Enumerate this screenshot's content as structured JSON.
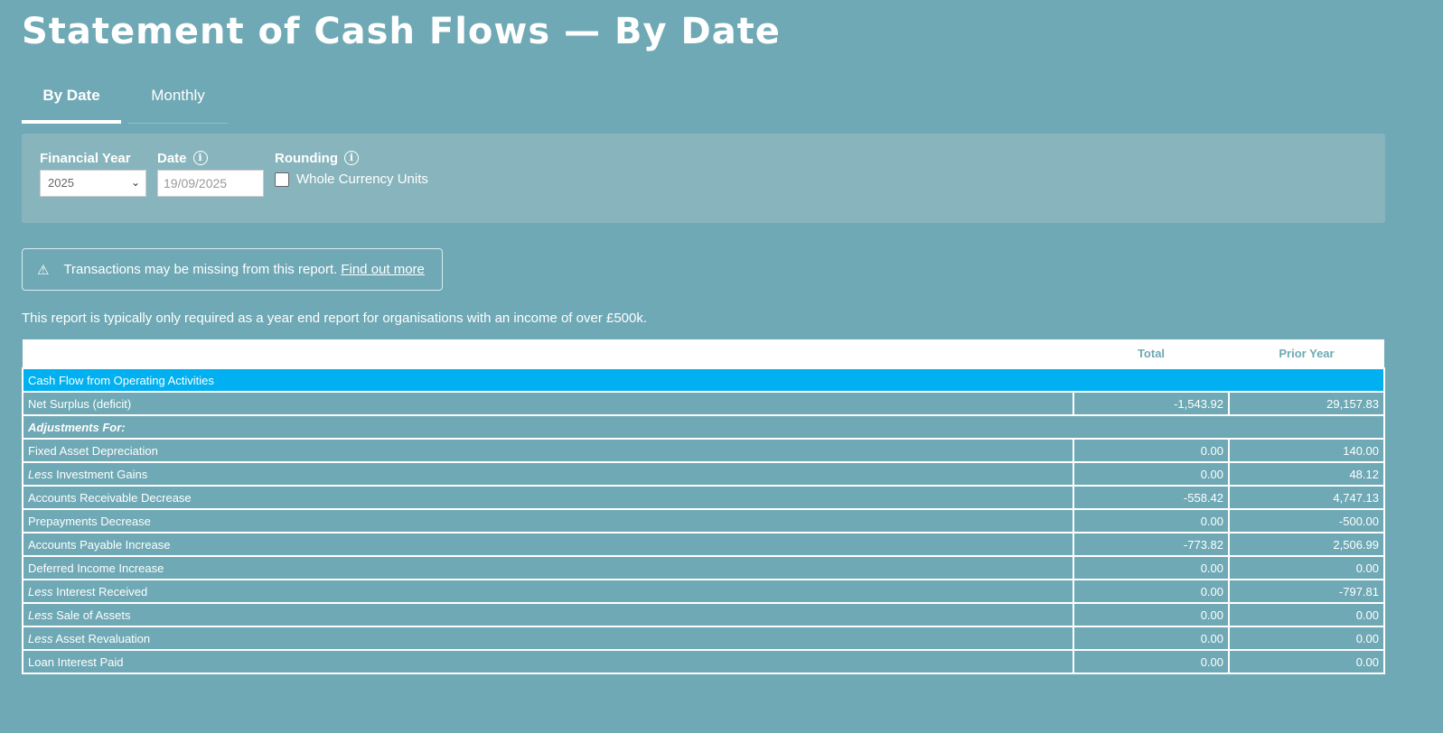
{
  "header": {
    "title": "Statement of Cash Flows — By Date"
  },
  "tabs": [
    {
      "label": "By Date",
      "active": true
    },
    {
      "label": "Monthly",
      "active": false
    }
  ],
  "filters": {
    "financial_year": {
      "label": "Financial Year",
      "value": "2025"
    },
    "date": {
      "label": "Date",
      "value": "19/09/2025"
    },
    "rounding": {
      "label": "Rounding",
      "checkbox_label": "Whole Currency Units",
      "checked": false
    }
  },
  "alert": {
    "text": "Transactions may be missing from this report.",
    "link": "Find out more"
  },
  "note": "This report is typically only required as a year end report for organisations with an income of over £500k.",
  "table": {
    "columns": [
      "",
      "Total",
      "Prior Year"
    ],
    "section": "Cash Flow from Operating Activities",
    "net_surplus": {
      "label": "Net Surplus (deficit)",
      "total": "-1,543.92",
      "prior": "29,157.83"
    },
    "adjustments_label": "Adjustments For:",
    "rows": [
      {
        "prefix": "",
        "label": "Fixed Asset Depreciation",
        "total": "0.00",
        "prior": "140.00"
      },
      {
        "prefix": "Less",
        "label": " Investment Gains",
        "total": "0.00",
        "prior": "48.12"
      },
      {
        "prefix": "",
        "label": "Accounts Receivable Decrease",
        "total": "-558.42",
        "prior": "4,747.13"
      },
      {
        "prefix": "",
        "label": "Prepayments Decrease",
        "total": "0.00",
        "prior": "-500.00"
      },
      {
        "prefix": "",
        "label": "Accounts Payable Increase",
        "total": "-773.82",
        "prior": "2,506.99"
      },
      {
        "prefix": "",
        "label": "Deferred Income Increase",
        "total": "0.00",
        "prior": "0.00"
      },
      {
        "prefix": "Less",
        "label": " Interest Received",
        "total": "0.00",
        "prior": "-797.81"
      },
      {
        "prefix": "Less",
        "label": " Sale of Assets",
        "total": "0.00",
        "prior": "0.00"
      },
      {
        "prefix": "Less",
        "label": " Asset Revaluation",
        "total": "0.00",
        "prior": "0.00"
      },
      {
        "prefix": "",
        "label": "Loan Interest Paid",
        "total": "0.00",
        "prior": "0.00"
      }
    ]
  },
  "colors": {
    "background": "#6fa9b5",
    "panel": "#88b5bd",
    "section": "#00b0f0"
  },
  "icons": {
    "warning": "warning-icon",
    "info": "info-icon",
    "dropdown": "chevron-down-icon"
  }
}
